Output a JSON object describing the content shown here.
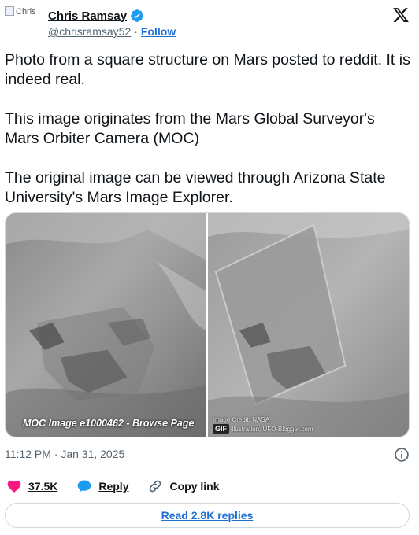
{
  "author": {
    "avatar_alt": "Chris",
    "name": "Chris Ramsay",
    "handle": "@chrisramsay52",
    "separator": "·",
    "follow_label": "Follow",
    "verified": true
  },
  "tweet": {
    "paragraphs": [
      "Photo from a square structure on Mars posted to reddit. It is indeed real.",
      "This image originates from the Mars Global Surveyor's Mars Orbiter Camera (MOC)",
      "The original image can be viewed through Arizona State University's Mars Image Explorer."
    ]
  },
  "media": {
    "left_caption": "MOC Image e1000462 - Browse Page",
    "right_credit_line1": "Image Credit: NASA",
    "right_credit_line2": "illustration: UFO-Blogger.com",
    "gif_badge": "GIF"
  },
  "meta": {
    "timestamp": "11:12 PM · Jan 31, 2025"
  },
  "actions": {
    "like_count": "37.5K",
    "reply_label": "Reply",
    "copy_label": "Copy link",
    "read_replies_label": "Read 2.8K replies"
  },
  "colors": {
    "like": "#f91880",
    "reply": "#1d9bf0",
    "link": "#1d6fd1",
    "verified": "#1d9bf0"
  }
}
